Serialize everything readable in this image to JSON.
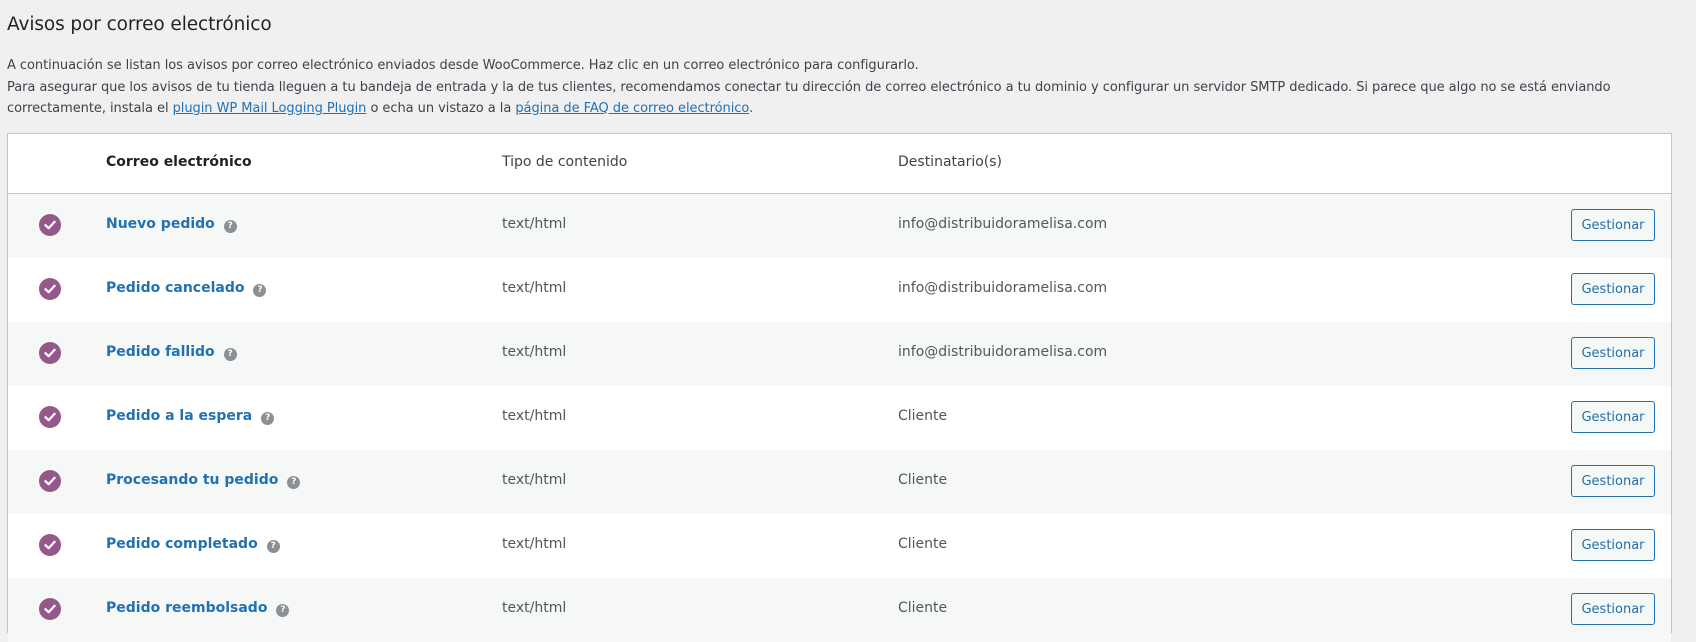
{
  "page": {
    "title": "Avisos por correo electrónico",
    "intro_line1": "A continuación se listan los avisos por correo electrónico enviados desde WooCommerce. Haz clic en un correo electrónico para configurarlo.",
    "intro_line2_part1": "Para asegurar que los avisos de tu tienda lleguen a tu bandeja de entrada y la de tus clientes, recomendamos conectar tu dirección de correo electrónico a tu dominio y configurar un servidor SMTP dedicado. Si parece que algo no se está enviando correctamente, instala el ",
    "link_plugin": "plugin WP Mail Logging Plugin",
    "intro_line2_part2": " o echa un vistazo a la ",
    "link_faq": "página de FAQ de correo electrónico",
    "intro_line2_part3": "."
  },
  "table": {
    "headers": {
      "email": "Correo electrónico",
      "content_type": "Tipo de contenido",
      "recipients": "Destinatario(s)"
    },
    "rows": [
      {
        "name": "Nuevo pedido",
        "content_type": "text/html",
        "recipient": "info@distribuidoramelisa.com",
        "action": "Gestionar"
      },
      {
        "name": "Pedido cancelado",
        "content_type": "text/html",
        "recipient": "info@distribuidoramelisa.com",
        "action": "Gestionar"
      },
      {
        "name": "Pedido fallido",
        "content_type": "text/html",
        "recipient": "info@distribuidoramelisa.com",
        "action": "Gestionar"
      },
      {
        "name": "Pedido a la espera",
        "content_type": "text/html",
        "recipient": "Cliente",
        "action": "Gestionar"
      },
      {
        "name": "Procesando tu pedido",
        "content_type": "text/html",
        "recipient": "Cliente",
        "action": "Gestionar"
      },
      {
        "name": "Pedido completado",
        "content_type": "text/html",
        "recipient": "Cliente",
        "action": "Gestionar"
      },
      {
        "name": "Pedido reembolsado",
        "content_type": "text/html",
        "recipient": "Cliente",
        "action": "Gestionar"
      }
    ]
  },
  "icons": {
    "status": "check-circle-icon",
    "help": "help-icon"
  },
  "colors": {
    "accent": "#96588a",
    "link": "#2271b1"
  }
}
